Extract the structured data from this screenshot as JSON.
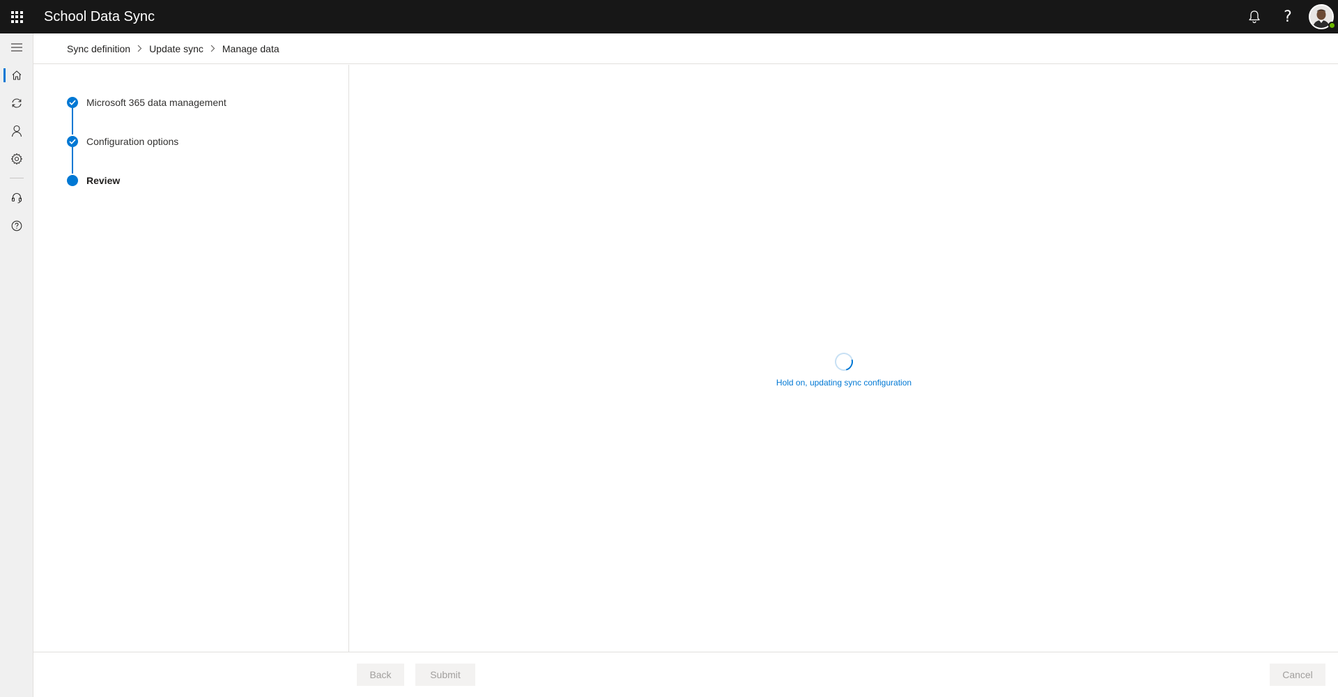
{
  "app": {
    "title": "School Data Sync"
  },
  "header": {
    "icons": [
      "waffle-icon",
      "bell-icon",
      "help-icon",
      "avatar"
    ],
    "help_glyph": "?"
  },
  "rail": {
    "items": [
      {
        "name": "menu-icon"
      },
      {
        "name": "home-icon",
        "active": true
      },
      {
        "name": "sync-icon"
      },
      {
        "name": "person-icon"
      },
      {
        "name": "gear-icon"
      },
      {
        "name": "headset-icon"
      },
      {
        "name": "help-circle-icon"
      }
    ]
  },
  "breadcrumb": {
    "items": [
      "Sync definition",
      "Update sync",
      "Manage data"
    ]
  },
  "steps": {
    "items": [
      {
        "label": "Microsoft 365 data management",
        "status": "completed"
      },
      {
        "label": "Configuration options",
        "status": "completed"
      },
      {
        "label": "Review",
        "status": "current"
      }
    ]
  },
  "main": {
    "loading_text": "Hold on, updating sync configuration"
  },
  "footer": {
    "back_label": "Back",
    "submit_label": "Submit",
    "cancel_label": "Cancel"
  },
  "colors": {
    "accent": "#0078d4",
    "topbar": "#171717",
    "presence": "#6bb700"
  }
}
